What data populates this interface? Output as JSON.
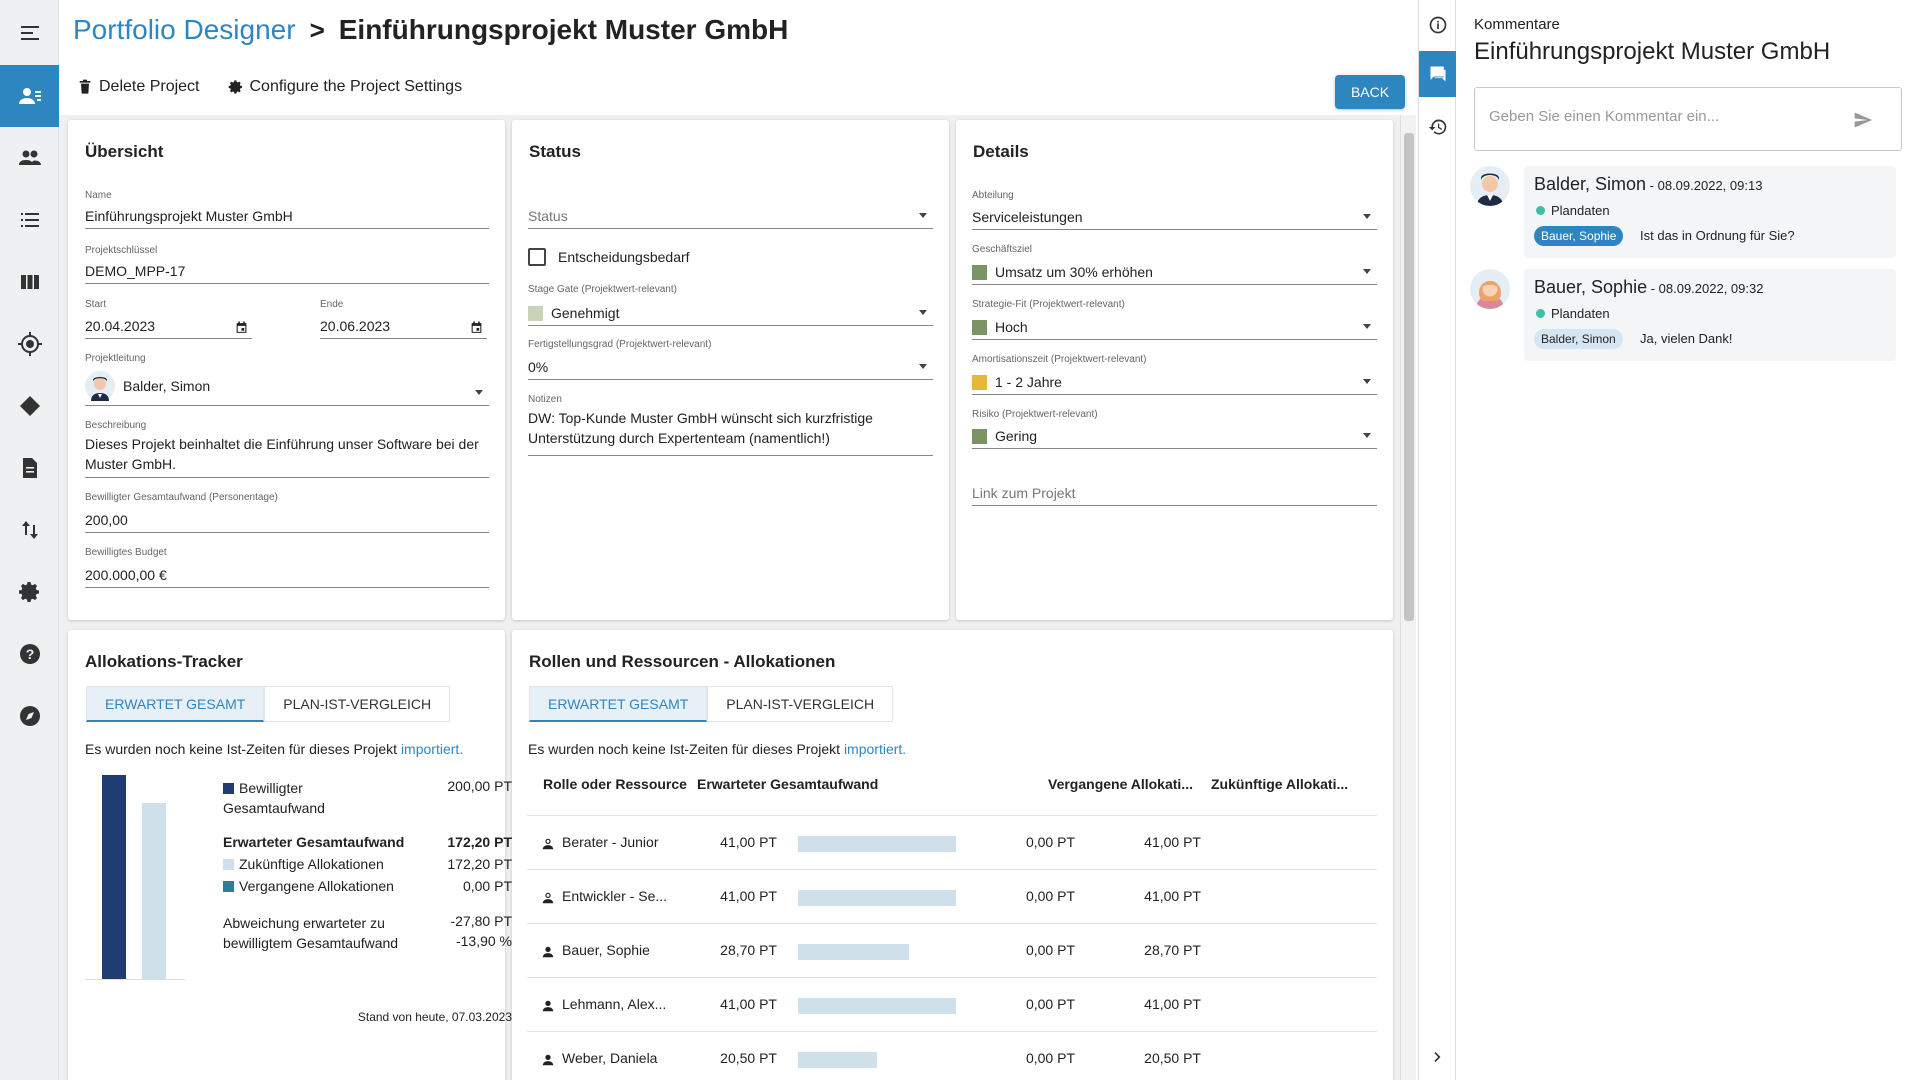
{
  "header": {
    "app_name": "Portfolio Designer",
    "separator": ">",
    "page_title": "Einführungsprojekt Muster GmbH",
    "delete_label": "Delete Project",
    "settings_label": "Configure the Project Settings",
    "back_label": "BACK"
  },
  "overview": {
    "title": "Übersicht",
    "name_label": "Name",
    "name_value": "Einführungsprojekt Muster GmbH",
    "key_label": "Projektschlüssel",
    "key_value": "DEMO_MPP-17",
    "start_label": "Start",
    "start_value": "20.04.2023",
    "end_label": "Ende",
    "end_value": "20.06.2023",
    "lead_label": "Projektleitung",
    "lead_value": "Balder, Simon",
    "desc_label": "Beschreibung",
    "desc_value": "Dieses Projekt beinhaltet die Einführung unser Software bei der Muster GmbH.",
    "effort_label": "Bewilligter Gesamtaufwand (Personentage)",
    "effort_value": "200,00",
    "budget_label": "Bewilligtes Budget",
    "budget_value": "200.000,00 €"
  },
  "status": {
    "title": "Status",
    "status_placeholder": "Status",
    "decision_label": "Entscheidungsbedarf",
    "decision_checked": false,
    "stage_label": "Stage Gate (Projektwert-relevant)",
    "stage_value": "Genehmigt",
    "stage_color": "#c9d3b8",
    "completion_label": "Fertigstellungsgrad (Projektwert-relevant)",
    "completion_value": "0%",
    "notes_label": "Notizen",
    "notes_value": "DW: Top-Kunde Muster GmbH wünscht sich kurzfristige Unterstützung durch Expertenteam (namentlich!)"
  },
  "details": {
    "title": "Details",
    "dept_label": "Abteilung",
    "dept_value": "Serviceleistungen",
    "goal_label": "Geschäftsziel",
    "goal_value": "Umsatz um 30% erhöhen",
    "fit_label": "Strategie-Fit (Projektwert-relevant)",
    "fit_value": "Hoch",
    "amort_label": "Amortisationszeit (Projektwert-relevant)",
    "amort_value": "1 - 2 Jahre",
    "risk_label": "Risiko (Projektwert-relevant)",
    "risk_value": "Gering",
    "link_placeholder": "Link zum Projekt",
    "green_color": "#7a9466",
    "yellow_color": "#e5b73b"
  },
  "tracker": {
    "title": "Allokations-Tracker",
    "tab_expected": "ERWARTET GESAMT",
    "tab_plan": "PLAN-IST-VERGLEICH",
    "note_prefix": "Es wurden noch keine Ist-Zeiten für dieses Projekt",
    "note_link": "importiert.",
    "approved_label": "Bewilligter Gesamtaufwand",
    "approved_value": "200,00 PT",
    "expected_label": "Erwarteter Gesamtaufwand",
    "expected_value": "172,20 PT",
    "future_label": "Zukünftige Allokationen",
    "future_value": "172,20 PT",
    "past_label": "Vergangene Allokationen",
    "past_value": "0,00 PT",
    "deviation_label": "Abweichung erwarteter zu bewilligtem Gesamtaufwand",
    "deviation_value": "-27,80 PT",
    "deviation_pct": "-13,90 %",
    "stand": "Stand von heute, 07.03.2023",
    "approved_color": "#1f3d73",
    "future_color": "#cfe0ea",
    "past_color": "#2a7f9a",
    "bar_approved": 200,
    "bar_expected": 172.2
  },
  "roles": {
    "title": "Rollen und Ressourcen - Allokationen",
    "tab_expected": "ERWARTET GESAMT",
    "tab_plan": "PLAN-IST-VERGLEICH",
    "note_prefix": "Es wurden noch keine Ist-Zeiten für dieses Projekt",
    "note_link": "importiert.",
    "col_role": "Rolle oder Ressource",
    "col_expected": "Erwarteter Gesamtaufwand",
    "col_past": "Vergangene Allokati...",
    "col_future": "Zukünftige Allokati...",
    "rows": [
      {
        "name": "Berater - Junior",
        "expected": "41,00 PT",
        "fill": 41,
        "past": "0,00 PT",
        "future": "41,00 PT",
        "role": true
      },
      {
        "name": "Entwickler - Se...",
        "expected": "41,00 PT",
        "fill": 41,
        "past": "0,00 PT",
        "future": "41,00 PT",
        "role": true
      },
      {
        "name": "Bauer, Sophie",
        "expected": "28,70 PT",
        "fill": 28.7,
        "past": "0,00 PT",
        "future": "28,70 PT",
        "role": false
      },
      {
        "name": "Lehmann, Alex...",
        "expected": "41,00 PT",
        "fill": 41,
        "past": "0,00 PT",
        "future": "41,00 PT",
        "role": false
      },
      {
        "name": "Weber, Daniela",
        "expected": "20,50 PT",
        "fill": 20.5,
        "past": "0,00 PT",
        "future": "20,50 PT",
        "role": false
      }
    ]
  },
  "comments": {
    "label": "Kommentare",
    "title": "Einführungsprojekt Muster GmbH",
    "input_placeholder": "Geben Sie einen Kommentar ein...",
    "items": [
      {
        "author": "Balder, Simon",
        "date": " - 08.09.2022, 09:13",
        "tag": "Plandaten",
        "mention": "Bauer, Sophie",
        "text": "Ist das in Ordnung für Sie?"
      },
      {
        "author": "Bauer, Sophie",
        "date": " - 08.09.2022, 09:32",
        "tag": "Plandaten",
        "mention": "Balder, Simon",
        "text": "Ja, vielen Dank!"
      }
    ]
  }
}
